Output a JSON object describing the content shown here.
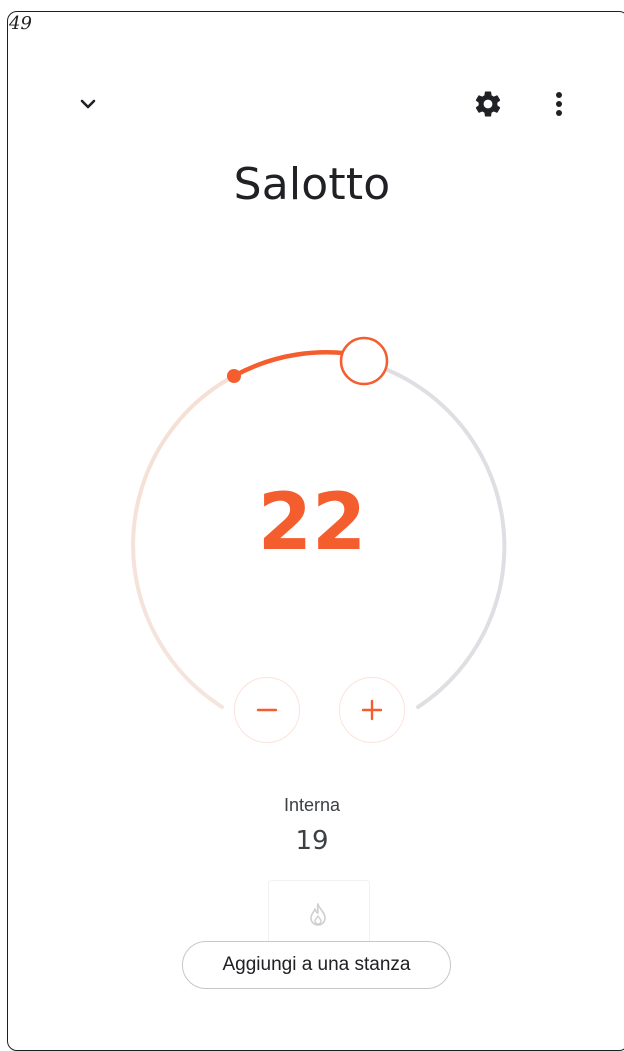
{
  "frame": {
    "number": "49"
  },
  "header": {
    "collapse_icon": "chevron-down-icon",
    "settings_icon": "gear-icon",
    "more_icon": "more-vert-icon"
  },
  "room": {
    "title": "Salotto"
  },
  "thermostat": {
    "setpoint": "22",
    "decrease_icon": "minus-icon",
    "increase_icon": "plus-icon",
    "colors": {
      "heat": "#f45d2e",
      "track": "#dfdfe3",
      "track_warm": "#f4e1d8"
    }
  },
  "indoor": {
    "label": "Interna",
    "value": "19"
  },
  "mode": {
    "icon": "flame-icon"
  },
  "add_room_button": {
    "label": "Aggiungi a una stanza"
  }
}
